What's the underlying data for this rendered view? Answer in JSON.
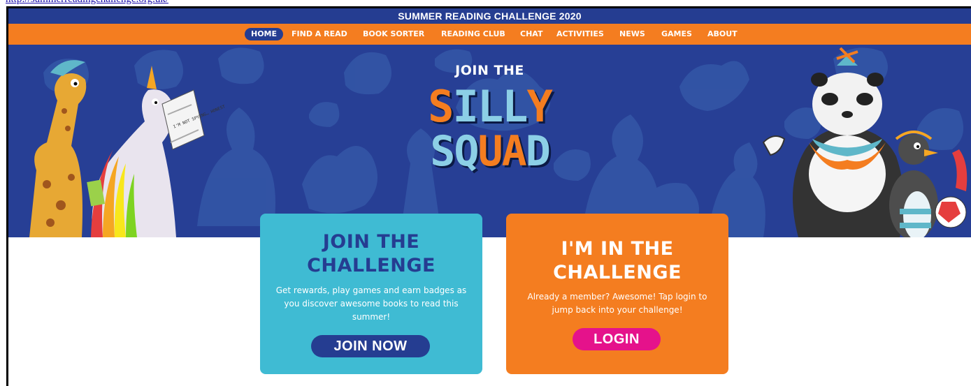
{
  "top_link": {
    "text": "http://summerreadingchallenge.org.uk/"
  },
  "banner": {
    "title": "SUMMER READING CHALLENGE 2020"
  },
  "nav": {
    "items": [
      {
        "label": "HOME"
      },
      {
        "label": "FIND A READ"
      },
      {
        "label": "BOOK SORTER"
      },
      {
        "label": "READING CLUB"
      },
      {
        "label": "CHAT"
      },
      {
        "label": "ACTIVITIES"
      },
      {
        "label": "NEWS"
      },
      {
        "label": "GAMES"
      },
      {
        "label": "ABOUT"
      }
    ],
    "active": "HOME"
  },
  "hero": {
    "join_the": "JOIN THE",
    "logo_silly": [
      "S",
      "I",
      "L",
      "L",
      "Y"
    ],
    "logo_squad": [
      "S",
      "Q",
      "U",
      "A",
      "D"
    ],
    "newspaper_text": "I'M NOT SPYING… HONEST"
  },
  "cards": {
    "join": {
      "title_line1": "JOIN THE",
      "title_line2": "CHALLENGE",
      "text": "Get rewards, play games and earn badges as you discover awesome books to read this summer!",
      "button_label": "JOIN NOW"
    },
    "login": {
      "title_line1": "I'M IN THE",
      "title_line2": "CHALLENGE",
      "text": "Already a member? Awesome! Tap login to jump back into your challenge!",
      "button_label": "LOGIN"
    }
  },
  "colors": {
    "navy": "#253d91",
    "orange": "#f47d20",
    "teal": "#3fbbd3",
    "pink": "#e5128b",
    "light_blue": "#8ccfe6"
  }
}
